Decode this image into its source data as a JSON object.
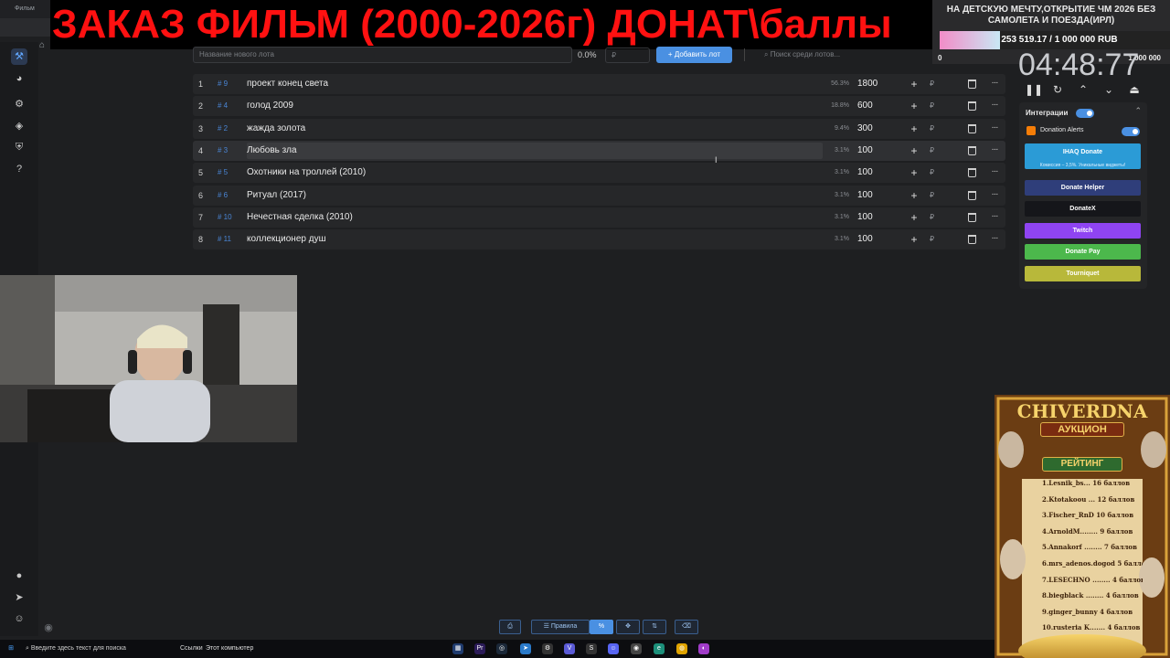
{
  "browser": {
    "tab_title": "Фильм"
  },
  "banner": {
    "text": "ЗАКАЗ ФИЛЬМ (2000-2026г) ДОНАТ\\баллы"
  },
  "toolbar": {
    "new_lot_placeholder": "Название нового лота",
    "percent": "0.0%",
    "amount_placeholder": "₽",
    "add_lot_label": "Добавить лот",
    "search_placeholder": "Поиск среди лотов..."
  },
  "lots": [
    {
      "num": "1",
      "id": "# 9",
      "name": "проект конец света",
      "pct": "56.3%",
      "amount": "1800"
    },
    {
      "num": "2",
      "id": "# 4",
      "name": "голод 2009",
      "pct": "18.8%",
      "amount": "600"
    },
    {
      "num": "3",
      "id": "# 2",
      "name": "жажда золота",
      "pct": "9.4%",
      "amount": "300"
    },
    {
      "num": "4",
      "id": "# 3",
      "name": "Любовь зла",
      "pct": "3.1%",
      "amount": "100"
    },
    {
      "num": "5",
      "id": "# 5",
      "name": "Охотники на троллей (2010)",
      "pct": "3.1%",
      "amount": "100"
    },
    {
      "num": "6",
      "id": "# 6",
      "name": "Ритуал (2017)",
      "pct": "3.1%",
      "amount": "100"
    },
    {
      "num": "7",
      "id": "# 10",
      "name": " Нечестная сделка (2010)",
      "pct": "3.1%",
      "amount": "100"
    },
    {
      "num": "8",
      "id": "# 11",
      "name": "коллекционер душ",
      "pct": "3.1%",
      "amount": "100"
    }
  ],
  "row_actions": {
    "plus": "+",
    "currency": "₽",
    "more": "···"
  },
  "goal": {
    "title": "НА ДЕТСКУЮ МЕЧТУ,ОТКРЫТИЕ ЧМ 2026 БЕЗ САМОЛЕТА И ПОЕЗДА(ИРЛ)",
    "progress_text": "253 519.17 / 1 000 000 RUB",
    "progress_fraction": 0.2535,
    "min": "0",
    "max": "1 000 000"
  },
  "timer": "04:48:77",
  "integrations": {
    "title": "Интеграции",
    "donation_alerts": "Donation Alerts",
    "providers": [
      {
        "label": "IHAQ Donate",
        "sub": "Комиссия – 3,5%. Уникальные виджеты!",
        "color": "#2b9bd6",
        "text_color": "#ffffff"
      },
      {
        "label": "Donate Helper",
        "color": "#2f3e7a",
        "text_color": "#ffffff"
      },
      {
        "label": "DonateX",
        "color": "#15161a",
        "text_color": "#ffffff"
      },
      {
        "label": "Twitch",
        "color": "#8f44f2",
        "text_color": "#ffffff"
      },
      {
        "label": "Donate Pay",
        "color": "#4cb84c",
        "text_color": "#ffffff"
      },
      {
        "label": "Tourniquet",
        "color": "#b8b83a",
        "text_color": "#ffffff"
      }
    ]
  },
  "auction_overlay": {
    "title": "CHIVERDNA",
    "subtitle": "АУКЦИОН",
    "rating_label": "РЕЙТИНГ",
    "entries": [
      "1.Lesnik_bs... 16 баллов",
      "2.Ktotakoou ... 12 баллов",
      "3.Fischer_RnD 10 баллов",
      "4.ArnoldM........ 9 баллов",
      "5.Annakorf ........ 7 баллов",
      "6.mrs_adenos.dogod 5 баллов",
      "7.LESECHNO ........ 4 баллов",
      "8.biegblack ........ 4 баллов",
      "9.ginger_bunny 4 баллов",
      "10.rusteria K....... 4 баллов"
    ]
  },
  "bottom_bar": {
    "rules_label": "Правила",
    "percent_label": "%"
  },
  "taskbar": {
    "search_placeholder": "Введите здесь текст для поиска",
    "links_label": "Ссылки",
    "computer_label": "Этот компьютер"
  }
}
